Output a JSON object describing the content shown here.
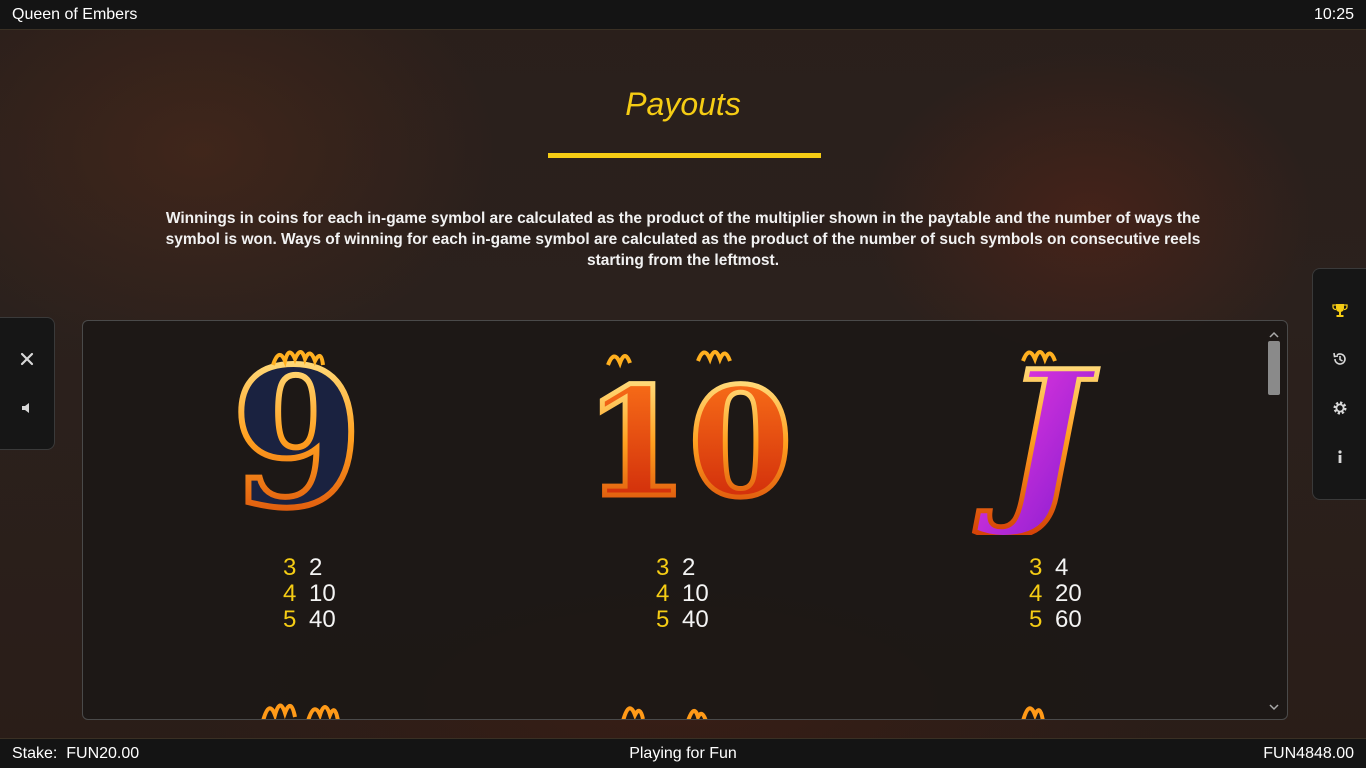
{
  "header": {
    "app_title": "Queen of Embers",
    "clock": "10:25"
  },
  "page": {
    "title": "Payouts",
    "description": "Winnings in coins for each in-game symbol are calculated as the product of the multiplier shown in the paytable and the number of ways the symbol is won. Ways of winning for each in-game symbol are calculated as the product of the number of such symbols on consecutive reels starting from the leftmost."
  },
  "left_controls": [
    {
      "icon": "close-icon",
      "glyph": "✕"
    },
    {
      "icon": "sound-icon",
      "glyph": "◀"
    }
  ],
  "right_controls": [
    {
      "icon": "trophy-icon"
    },
    {
      "icon": "history-icon"
    },
    {
      "icon": "settings-icon"
    },
    {
      "icon": "info-icon"
    }
  ],
  "symbols": [
    {
      "name": "9",
      "glyph": "9",
      "fill": "#1a2240",
      "payouts": [
        {
          "count": "3",
          "value": "2"
        },
        {
          "count": "4",
          "value": "10"
        },
        {
          "count": "5",
          "value": "40"
        }
      ]
    },
    {
      "name": "10",
      "glyph": "10",
      "fill": "#d8320a",
      "payouts": [
        {
          "count": "3",
          "value": "2"
        },
        {
          "count": "4",
          "value": "10"
        },
        {
          "count": "5",
          "value": "40"
        }
      ]
    },
    {
      "name": "J",
      "glyph": "J",
      "fill": "#b024d8",
      "payouts": [
        {
          "count": "3",
          "value": "4"
        },
        {
          "count": "4",
          "value": "20"
        },
        {
          "count": "5",
          "value": "60"
        }
      ]
    }
  ],
  "footer": {
    "stake_label": "Stake:",
    "stake_value": "FUN20.00",
    "mode": "Playing for Fun",
    "balance": "FUN4848.00"
  },
  "colors": {
    "accent": "#f5cc14",
    "bar_bg": "#141414"
  }
}
